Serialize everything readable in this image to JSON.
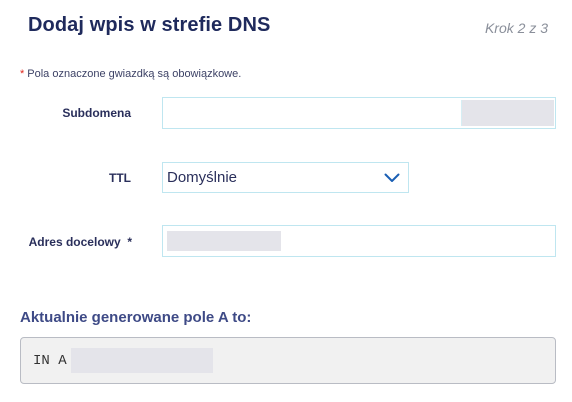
{
  "header": {
    "title": "Dodaj wpis w strefie DNS",
    "step": "Krok 2 z 3"
  },
  "form": {
    "required_asterisk": "*",
    "required_note": "Pola oznaczone gwiazdką są obowiązkowe.",
    "subdomain": {
      "label": "Subdomena",
      "value": ""
    },
    "ttl": {
      "label": "TTL",
      "selected": "Domyślnie",
      "icon": "chevron-down-icon"
    },
    "target": {
      "label": "Adres docelowy  *",
      "value": ""
    }
  },
  "preview": {
    "heading": "Aktualnie generowane pole A to:",
    "prefix": "IN A"
  },
  "colors": {
    "title": "#1f2a5c",
    "accent": "#1a5fb4",
    "field_border": "#bfe6f0",
    "required": "#e0261b"
  }
}
